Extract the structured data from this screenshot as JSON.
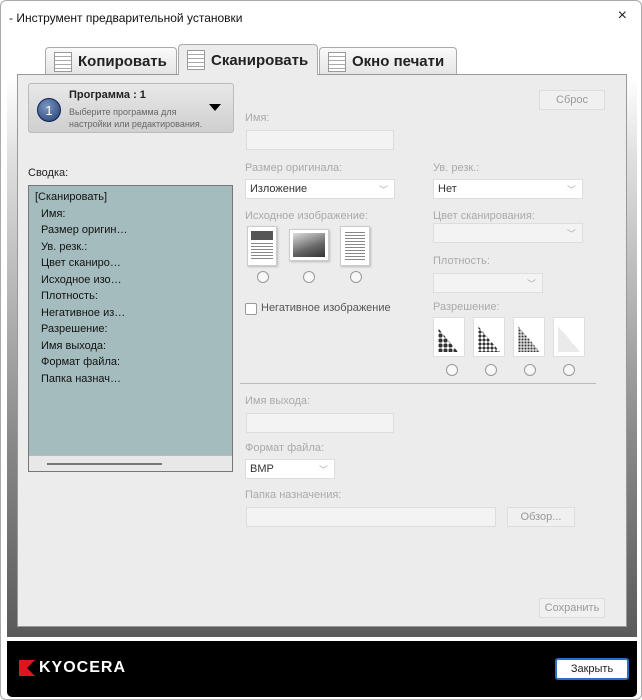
{
  "window": {
    "title": "- Инструмент предварительной установки",
    "close_icon": "×"
  },
  "tabs": [
    {
      "label": "Копировать"
    },
    {
      "label": "Сканировать"
    },
    {
      "label": "Окно печати"
    }
  ],
  "program": {
    "number": "1",
    "title": "Программа : 1",
    "subtitle": "Выберите программа для настройки или редактирования."
  },
  "summary": {
    "label": "Сводка:",
    "items": [
      "[Сканировать]",
      "Имя:",
      "Размер оригин…",
      "Ув. резк.:",
      "Цвет сканиро…",
      "Исходное изо…",
      "Плотность:",
      "Негативное из…",
      "Разрешение:",
      "Имя выхода:",
      "Формат файла:",
      "Папка назнач…"
    ]
  },
  "form": {
    "reset": "Сброс",
    "name_label": "Имя:",
    "name_value": "",
    "orig_size_label": "Размер оригинала:",
    "orig_size_value": "Изложение",
    "sharp_label": "Ув. резк.:",
    "sharp_value": "Нет",
    "source_label": "Исходное изображение:",
    "color_label": "Цвет сканирования:",
    "color_value": "",
    "density_label": "Плотность:",
    "density_value": "",
    "negative_label": "Негативное изображение",
    "resolution_label": "Разрешение:",
    "output_label": "Имя выхода:",
    "output_value": "",
    "format_label": "Формат файла:",
    "format_value": "BMP",
    "folder_label": "Папка назначения:",
    "folder_value": "",
    "browse": "Обзор...",
    "save": "Сохранить"
  },
  "footer": {
    "brand": "KYOCERA",
    "close": "Закрыть"
  }
}
